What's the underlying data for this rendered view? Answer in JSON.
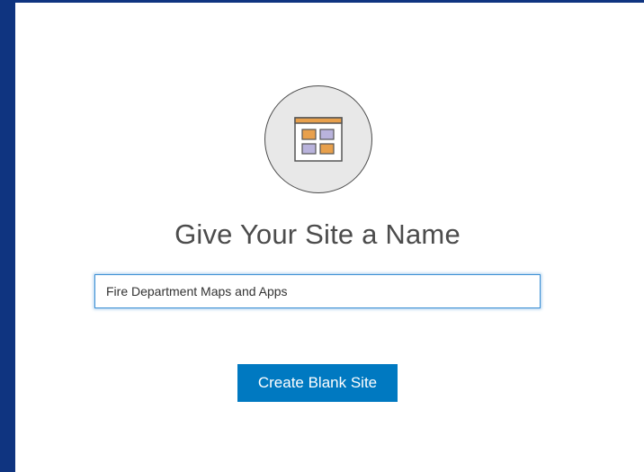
{
  "dialog": {
    "icon": "site-layout-icon",
    "title": "Give Your Site a Name",
    "name_input": {
      "value": "Fire Department Maps and Apps",
      "placeholder": ""
    },
    "create_button_label": "Create Blank Site"
  },
  "colors": {
    "background": "#0f3480",
    "button": "#0079c1",
    "input_focus_border": "#3b8fd4",
    "icon_orange": "#e8a04c",
    "icon_purple": "#b9b3dc"
  }
}
